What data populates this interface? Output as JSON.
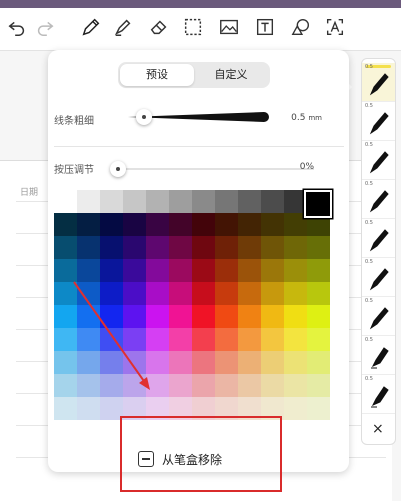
{
  "popup": {
    "tabs": [
      {
        "label": "预设",
        "active": true
      },
      {
        "label": "自定义",
        "active": false
      }
    ],
    "thickness": {
      "label": "线条粗细",
      "value": "0.5",
      "unit": "mm",
      "fraction": 0.12
    },
    "pressure": {
      "label": "按压调节",
      "value": "0%",
      "fraction": 0.0
    },
    "selected_color": "#000000",
    "remove_label": "从笔盒移除"
  },
  "background_doc": {
    "date_label": "日期"
  },
  "pen_panel": {
    "pens": [
      {
        "size": "0.5",
        "selected": true
      },
      {
        "size": "0.5",
        "selected": false
      },
      {
        "size": "0.5",
        "selected": false
      },
      {
        "size": "0.5",
        "selected": false
      },
      {
        "size": "0.5",
        "selected": false
      },
      {
        "size": "0.5",
        "selected": false
      },
      {
        "size": "0.5",
        "selected": false
      },
      {
        "size": "0.5",
        "selected": false
      },
      {
        "size": "0.5",
        "selected": false
      }
    ],
    "close_symbol": "×"
  },
  "colors": {
    "accent_bar": "#6b5a7c",
    "highlight_border": "#d92b2b",
    "annotation_arrow": "#e03030"
  },
  "icons": [
    "undo-icon",
    "redo-icon",
    "pen-icon",
    "highlighter-icon",
    "eraser-icon",
    "lasso-select-icon",
    "image-icon",
    "text-box-icon",
    "shape-icon",
    "text-recognition-icon"
  ]
}
